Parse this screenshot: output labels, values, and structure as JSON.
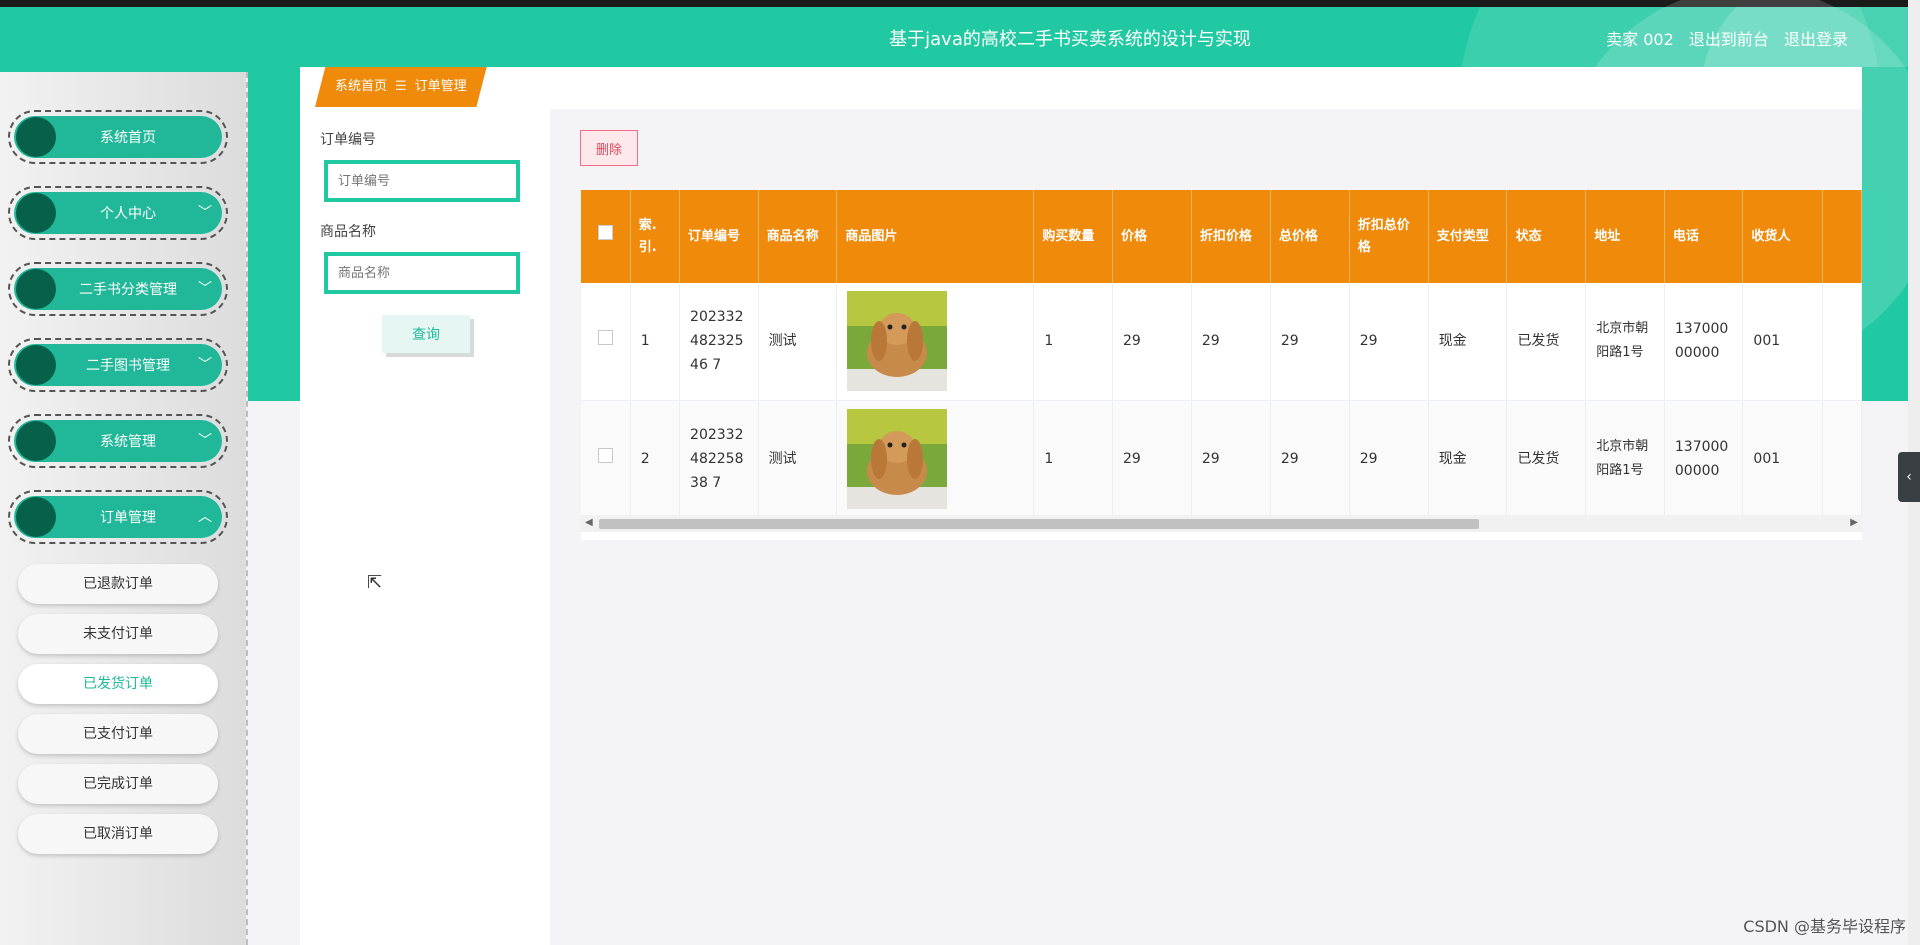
{
  "header": {
    "title": "基于java的高校二手书买卖系统的设计与实现",
    "user": "卖家 002",
    "links": [
      "退出到前台",
      "退出登录"
    ]
  },
  "sidebar": {
    "items": [
      {
        "label": "系统首页",
        "chevron": ""
      },
      {
        "label": "个人中心",
        "chevron": "﹀"
      },
      {
        "label": "二手书分类管理",
        "chevron": "﹀"
      },
      {
        "label": "二手图书管理",
        "chevron": "﹀"
      },
      {
        "label": "系统管理",
        "chevron": "﹀"
      },
      {
        "label": "订单管理",
        "chevron": "︿"
      }
    ],
    "sub_items": [
      "已退款订单",
      "未支付订单",
      "已发货订单",
      "已支付订单",
      "已完成订单",
      "已取消订单"
    ],
    "active_sub": "已发货订单"
  },
  "breadcrumb": {
    "home": "系统首页",
    "sep": "☰",
    "current": "订单管理"
  },
  "search": {
    "order_no_label": "订单编号",
    "order_no_placeholder": "订单编号",
    "product_label": "商品名称",
    "product_placeholder": "商品名称",
    "query_button": "查询"
  },
  "toolbar": {
    "delete_label": "删除"
  },
  "table": {
    "headers": [
      "索.引.",
      "订单编号",
      "商品名称",
      "商品图片",
      "购买数量",
      "价格",
      "折扣价格",
      "总价格",
      "折扣总价格",
      "支付类型",
      "状态",
      "地址",
      "电话",
      "收货人"
    ],
    "rows": [
      {
        "index": "1",
        "order_no": "20233248232546 7",
        "product": "测试",
        "qty": "1",
        "price": "29",
        "discount_price": "29",
        "total": "29",
        "discount_total": "29",
        "pay_type": "现金",
        "status": "已发货",
        "address": "北京市朝阳路1号",
        "phone": "13700000000",
        "receiver": "001"
      },
      {
        "index": "2",
        "order_no": "20233248225838 7",
        "product": "测试",
        "qty": "1",
        "price": "29",
        "discount_price": "29",
        "total": "29",
        "discount_total": "29",
        "pay_type": "现金",
        "status": "已发货",
        "address": "北京市朝阳路1号",
        "phone": "13700000000",
        "receiver": "001"
      }
    ]
  },
  "watermark": "CSDN @基务毕设程序",
  "colors": {
    "primary": "#21c9a2",
    "menu": "#21b89a",
    "header_orange": "#ef8a0a",
    "danger": "#e04b5c"
  },
  "icons": {
    "checkbox": "checkbox-icon",
    "chevron": "chevron-down-icon",
    "collapse": "chevron-left-icon"
  }
}
